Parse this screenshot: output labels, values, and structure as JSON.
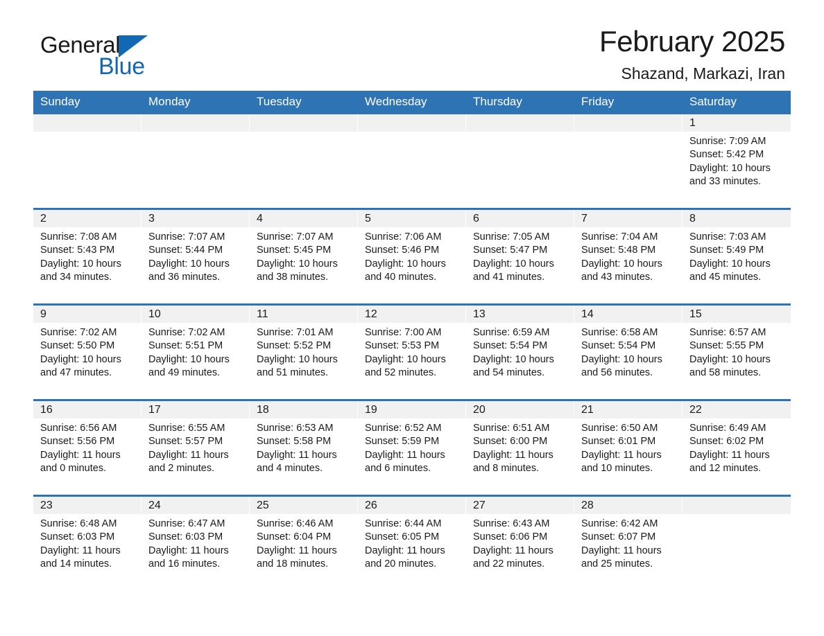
{
  "brand": {
    "name_part1": "General",
    "name_part2": "Blue",
    "triangle_color": "#1268b3"
  },
  "header": {
    "title": "February 2025",
    "subtitle": "Shazand, Markazi, Iran"
  },
  "theme": {
    "accent": "#2e74b5",
    "daynum_band": "#f1f1f1",
    "text": "#1a1a1a",
    "header_text": "#ffffff"
  },
  "weekdays": [
    "Sunday",
    "Monday",
    "Tuesday",
    "Wednesday",
    "Thursday",
    "Friday",
    "Saturday"
  ],
  "weeks": [
    [
      {
        "day": "",
        "lines": []
      },
      {
        "day": "",
        "lines": []
      },
      {
        "day": "",
        "lines": []
      },
      {
        "day": "",
        "lines": []
      },
      {
        "day": "",
        "lines": []
      },
      {
        "day": "",
        "lines": []
      },
      {
        "day": "1",
        "sunrise": "Sunrise: 7:09 AM",
        "sunset": "Sunset: 5:42 PM",
        "daylight": "Daylight: 10 hours and 33 minutes."
      }
    ],
    [
      {
        "day": "2",
        "sunrise": "Sunrise: 7:08 AM",
        "sunset": "Sunset: 5:43 PM",
        "daylight": "Daylight: 10 hours and 34 minutes."
      },
      {
        "day": "3",
        "sunrise": "Sunrise: 7:07 AM",
        "sunset": "Sunset: 5:44 PM",
        "daylight": "Daylight: 10 hours and 36 minutes."
      },
      {
        "day": "4",
        "sunrise": "Sunrise: 7:07 AM",
        "sunset": "Sunset: 5:45 PM",
        "daylight": "Daylight: 10 hours and 38 minutes."
      },
      {
        "day": "5",
        "sunrise": "Sunrise: 7:06 AM",
        "sunset": "Sunset: 5:46 PM",
        "daylight": "Daylight: 10 hours and 40 minutes."
      },
      {
        "day": "6",
        "sunrise": "Sunrise: 7:05 AM",
        "sunset": "Sunset: 5:47 PM",
        "daylight": "Daylight: 10 hours and 41 minutes."
      },
      {
        "day": "7",
        "sunrise": "Sunrise: 7:04 AM",
        "sunset": "Sunset: 5:48 PM",
        "daylight": "Daylight: 10 hours and 43 minutes."
      },
      {
        "day": "8",
        "sunrise": "Sunrise: 7:03 AM",
        "sunset": "Sunset: 5:49 PM",
        "daylight": "Daylight: 10 hours and 45 minutes."
      }
    ],
    [
      {
        "day": "9",
        "sunrise": "Sunrise: 7:02 AM",
        "sunset": "Sunset: 5:50 PM",
        "daylight": "Daylight: 10 hours and 47 minutes."
      },
      {
        "day": "10",
        "sunrise": "Sunrise: 7:02 AM",
        "sunset": "Sunset: 5:51 PM",
        "daylight": "Daylight: 10 hours and 49 minutes."
      },
      {
        "day": "11",
        "sunrise": "Sunrise: 7:01 AM",
        "sunset": "Sunset: 5:52 PM",
        "daylight": "Daylight: 10 hours and 51 minutes."
      },
      {
        "day": "12",
        "sunrise": "Sunrise: 7:00 AM",
        "sunset": "Sunset: 5:53 PM",
        "daylight": "Daylight: 10 hours and 52 minutes."
      },
      {
        "day": "13",
        "sunrise": "Sunrise: 6:59 AM",
        "sunset": "Sunset: 5:54 PM",
        "daylight": "Daylight: 10 hours and 54 minutes."
      },
      {
        "day": "14",
        "sunrise": "Sunrise: 6:58 AM",
        "sunset": "Sunset: 5:54 PM",
        "daylight": "Daylight: 10 hours and 56 minutes."
      },
      {
        "day": "15",
        "sunrise": "Sunrise: 6:57 AM",
        "sunset": "Sunset: 5:55 PM",
        "daylight": "Daylight: 10 hours and 58 minutes."
      }
    ],
    [
      {
        "day": "16",
        "sunrise": "Sunrise: 6:56 AM",
        "sunset": "Sunset: 5:56 PM",
        "daylight": "Daylight: 11 hours and 0 minutes."
      },
      {
        "day": "17",
        "sunrise": "Sunrise: 6:55 AM",
        "sunset": "Sunset: 5:57 PM",
        "daylight": "Daylight: 11 hours and 2 minutes."
      },
      {
        "day": "18",
        "sunrise": "Sunrise: 6:53 AM",
        "sunset": "Sunset: 5:58 PM",
        "daylight": "Daylight: 11 hours and 4 minutes."
      },
      {
        "day": "19",
        "sunrise": "Sunrise: 6:52 AM",
        "sunset": "Sunset: 5:59 PM",
        "daylight": "Daylight: 11 hours and 6 minutes."
      },
      {
        "day": "20",
        "sunrise": "Sunrise: 6:51 AM",
        "sunset": "Sunset: 6:00 PM",
        "daylight": "Daylight: 11 hours and 8 minutes."
      },
      {
        "day": "21",
        "sunrise": "Sunrise: 6:50 AM",
        "sunset": "Sunset: 6:01 PM",
        "daylight": "Daylight: 11 hours and 10 minutes."
      },
      {
        "day": "22",
        "sunrise": "Sunrise: 6:49 AM",
        "sunset": "Sunset: 6:02 PM",
        "daylight": "Daylight: 11 hours and 12 minutes."
      }
    ],
    [
      {
        "day": "23",
        "sunrise": "Sunrise: 6:48 AM",
        "sunset": "Sunset: 6:03 PM",
        "daylight": "Daylight: 11 hours and 14 minutes."
      },
      {
        "day": "24",
        "sunrise": "Sunrise: 6:47 AM",
        "sunset": "Sunset: 6:03 PM",
        "daylight": "Daylight: 11 hours and 16 minutes."
      },
      {
        "day": "25",
        "sunrise": "Sunrise: 6:46 AM",
        "sunset": "Sunset: 6:04 PM",
        "daylight": "Daylight: 11 hours and 18 minutes."
      },
      {
        "day": "26",
        "sunrise": "Sunrise: 6:44 AM",
        "sunset": "Sunset: 6:05 PM",
        "daylight": "Daylight: 11 hours and 20 minutes."
      },
      {
        "day": "27",
        "sunrise": "Sunrise: 6:43 AM",
        "sunset": "Sunset: 6:06 PM",
        "daylight": "Daylight: 11 hours and 22 minutes."
      },
      {
        "day": "28",
        "sunrise": "Sunrise: 6:42 AM",
        "sunset": "Sunset: 6:07 PM",
        "daylight": "Daylight: 11 hours and 25 minutes."
      },
      {
        "day": "",
        "lines": []
      }
    ]
  ]
}
